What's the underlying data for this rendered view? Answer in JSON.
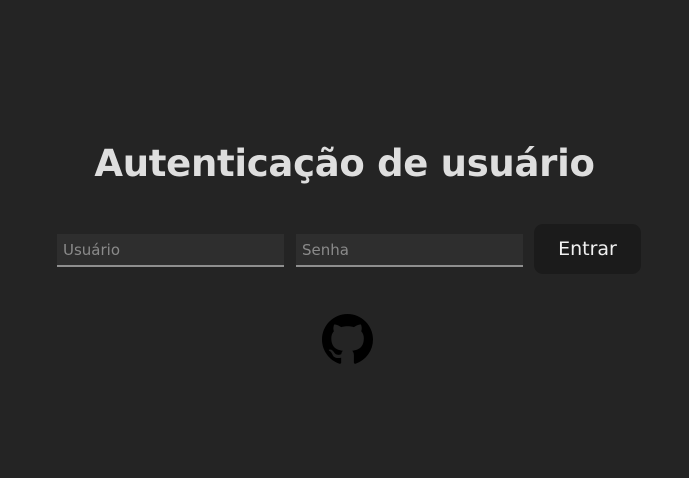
{
  "page": {
    "title": "Autenticação de usuário"
  },
  "login_form": {
    "username_placeholder": "Usuário",
    "username_value": "",
    "password_placeholder": "Senha",
    "password_value": "",
    "submit_label": "Entrar"
  },
  "footer": {
    "github_icon": "github-icon"
  },
  "colors": {
    "background": "#242424",
    "title_text": "#dedede",
    "input_background": "#2e2e2e",
    "input_underline": "#8f8f8f",
    "button_background": "#1b1b1b",
    "button_text": "#f0f0f0",
    "icon": "#000000"
  }
}
